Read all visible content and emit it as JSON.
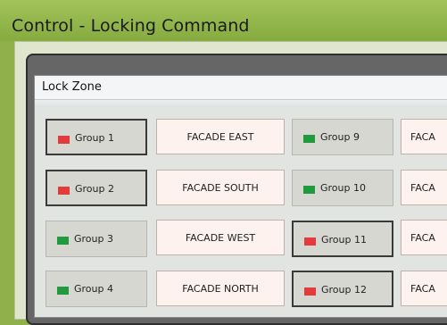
{
  "window": {
    "title": "Control - Locking Command"
  },
  "zone": {
    "title": "Lock Zone"
  },
  "groups": [
    {
      "label": "Group 1",
      "state": "red",
      "active": true
    },
    {
      "label": "Group 2",
      "state": "red",
      "active": true
    },
    {
      "label": "Group 3",
      "state": "green",
      "active": false
    },
    {
      "label": "Group 4",
      "state": "green",
      "active": false
    },
    {
      "label": "Group 9",
      "state": "green",
      "active": false
    },
    {
      "label": "Group 10",
      "state": "green",
      "active": false
    },
    {
      "label": "Group 11",
      "state": "red",
      "active": true
    },
    {
      "label": "Group 12",
      "state": "red",
      "active": true
    }
  ],
  "facades_col1": [
    "FACADE EAST",
    "FACADE SOUTH",
    "FACADE WEST",
    "FACADE NORTH"
  ],
  "facades_col2_visible": [
    "FACA",
    "FACA",
    "FACA",
    "FACA"
  ],
  "colors": {
    "red": "#e33b3b",
    "green": "#209a3c",
    "titlebar": "#8fb04a"
  }
}
